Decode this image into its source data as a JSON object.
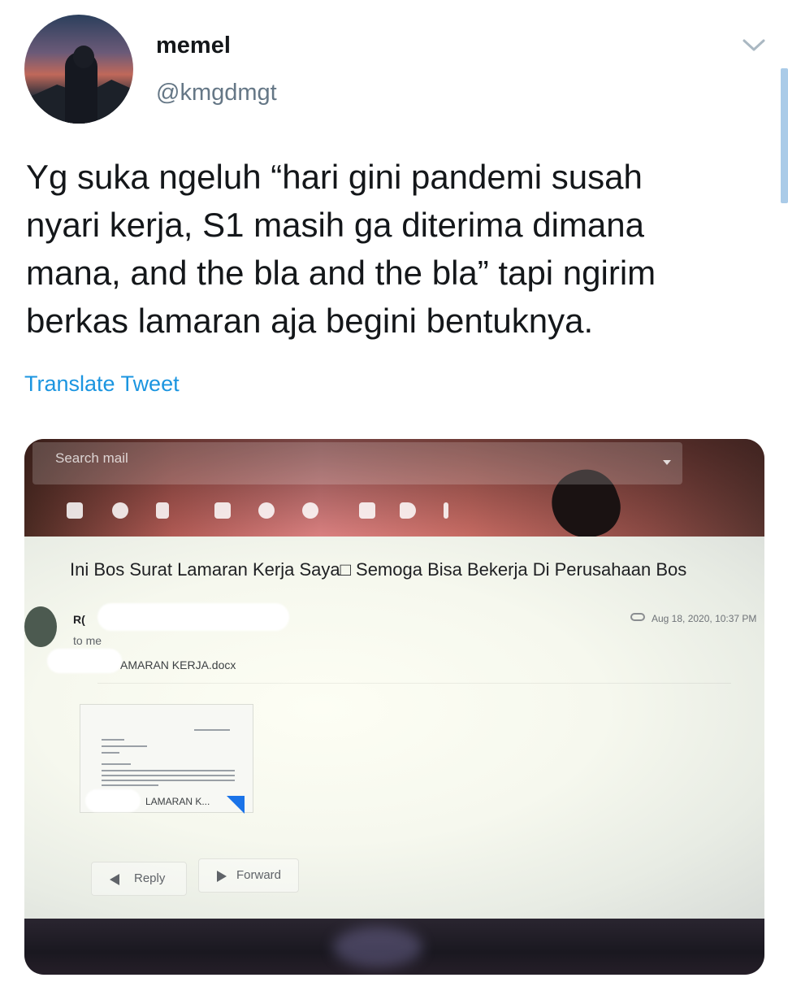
{
  "author": {
    "display_name": "memel",
    "handle": "@kmgdmgt",
    "avatar_icon": "profile-photo"
  },
  "tweet": {
    "text": "Yg suka ngeluh “hari gini pandemi susah\nnyari kerja, S1 masih ga diterima dimana\nmana, and the bla and the bla” tapi ngirim\nberkas lamaran aja begini bentuknya.",
    "translate_label": "Translate Tweet"
  },
  "menu": {
    "icon": "chevron-down-icon"
  },
  "colors": {
    "link": "#1b95e0",
    "handle": "#657786",
    "text": "#14171a"
  },
  "photo": {
    "search_placeholder": "Search mail",
    "toolbar_icons": [
      "archive-icon",
      "spam-icon",
      "delete-icon",
      "mark-unread-icon",
      "snooze-icon",
      "add-task-icon",
      "move-to-icon",
      "label-icon",
      "more-icon"
    ],
    "subject": "Ini Bos Surat Lamaran Kerja Saya□ Semoga Bisa Bekerja Di Perusahaan Bos",
    "sender_name": "R(",
    "to_me": "to me",
    "date": "Aug 18, 2020, 10:37 PM",
    "attachment_name": "AMARAN KERJA.docx",
    "attachment_label": "LAMARAN K...",
    "reply_label": "Reply",
    "forward_label": "Forward"
  }
}
